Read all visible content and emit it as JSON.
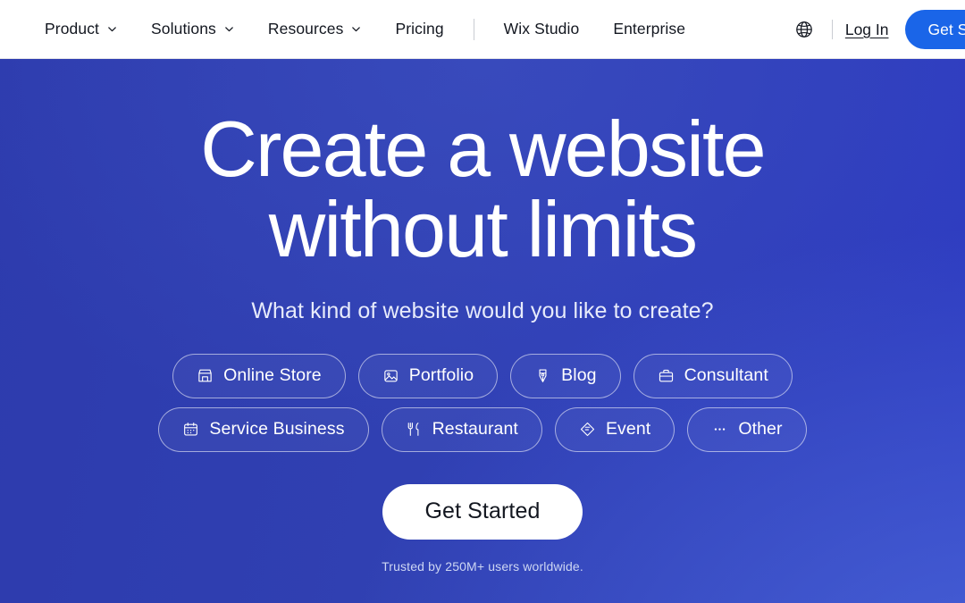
{
  "header": {
    "nav_items": [
      {
        "label": "Product",
        "has_caret": true,
        "name": "product"
      },
      {
        "label": "Solutions",
        "has_caret": true,
        "name": "solutions"
      },
      {
        "label": "Resources",
        "has_caret": true,
        "name": "resources"
      },
      {
        "label": "Pricing",
        "has_caret": false,
        "name": "pricing"
      }
    ],
    "nav_items_secondary": [
      {
        "label": "Wix Studio",
        "name": "wix-studio"
      },
      {
        "label": "Enterprise",
        "name": "enterprise"
      }
    ],
    "language_icon": "globe-icon",
    "login_label": "Log In",
    "cta_label": "Get Started",
    "cta_color": "#1a65e8",
    "background": "#ffffff",
    "text_color": "#131720"
  },
  "hero": {
    "headline_line1": "Create a website",
    "headline_line2": "without limits",
    "subhead": "What kind of website would you like to create?",
    "cta_label": "Get Started",
    "trust_text": "Trusted by 250M+ users worldwide.",
    "background_start": "#2d3bad",
    "background_end": "#2e3cc2",
    "text_color": "#ffffff",
    "categories_row1": [
      {
        "label": "Online Store",
        "icon": "store-icon"
      },
      {
        "label": "Portfolio",
        "icon": "image-portfolio-icon"
      },
      {
        "label": "Blog",
        "icon": "pen-nib-icon"
      },
      {
        "label": "Consultant",
        "icon": "briefcase-icon"
      }
    ],
    "categories_row2": [
      {
        "label": "Service Business",
        "icon": "calendar-icon"
      },
      {
        "label": "Restaurant",
        "icon": "fork-knife-icon"
      },
      {
        "label": "Event",
        "icon": "ticket-icon"
      },
      {
        "label": "Other",
        "icon": "ellipsis-icon"
      }
    ]
  }
}
